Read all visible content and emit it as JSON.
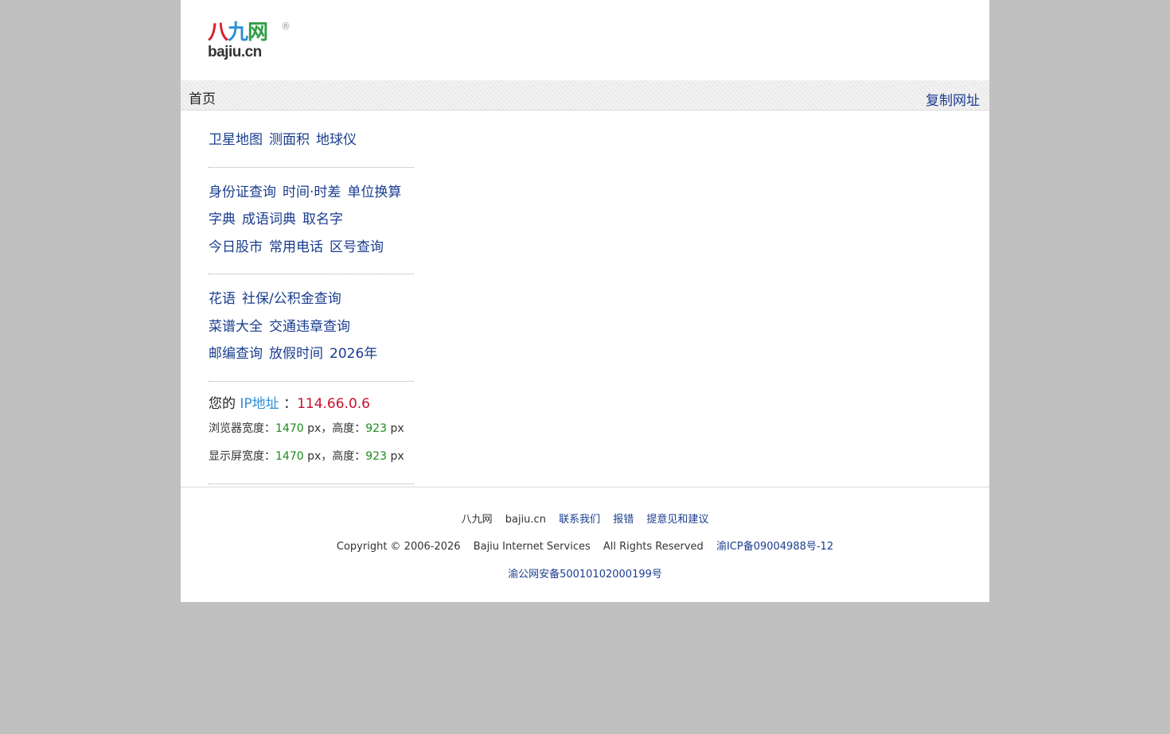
{
  "logo": {
    "chars": [
      "八",
      "九",
      "网"
    ],
    "domain": "bajiu.cn",
    "reg": "®"
  },
  "nav": {
    "home": "首页",
    "copy_url": "复制网址"
  },
  "groups": [
    {
      "rows": [
        [
          "卫星地图",
          "测面积",
          "地球仪"
        ]
      ]
    },
    {
      "rows": [
        [
          "身份证查询",
          "时间·时差",
          "单位换算"
        ],
        [
          "字典",
          "成语词典",
          "取名字"
        ],
        [
          "今日股市",
          "常用电话",
          "区号查询"
        ]
      ]
    },
    {
      "rows": [
        [
          "花语",
          "社保/公积金查询"
        ],
        [
          "菜谱大全",
          "交通违章查询"
        ],
        [
          "邮编查询",
          "放假时间",
          "2026年"
        ]
      ]
    }
  ],
  "info": {
    "ip_prefix": "您的",
    "ip_link": "IP地址",
    "ip_colon": "：",
    "ip_value": "114.66.0.6",
    "browser_label": "浏览器宽度：",
    "browser_width": "1470",
    "browser_mid": "px，高度：",
    "browser_height": "923",
    "browser_unit": "px",
    "screen_label": "显示屏宽度：",
    "screen_width": "1470",
    "screen_mid": "px，高度：",
    "screen_height": "923",
    "screen_unit": "px"
  },
  "footer": {
    "site_name": "八九网",
    "site_domain": "bajiu.cn",
    "contact": "联系我们",
    "report": "报错",
    "suggest": "提意见和建议",
    "copyright": "Copyright © 2006-2026",
    "company": "Bajiu Internet Services",
    "rights": "All Rights Reserved",
    "icp": "渝ICP备09004988号-12",
    "police": "渝公网安备50010102000199号"
  },
  "colors": {
    "background": "#c0c0c0",
    "link": "#1a3d8f",
    "ip_value": "#c8102e",
    "number": "#1c8a1c"
  }
}
